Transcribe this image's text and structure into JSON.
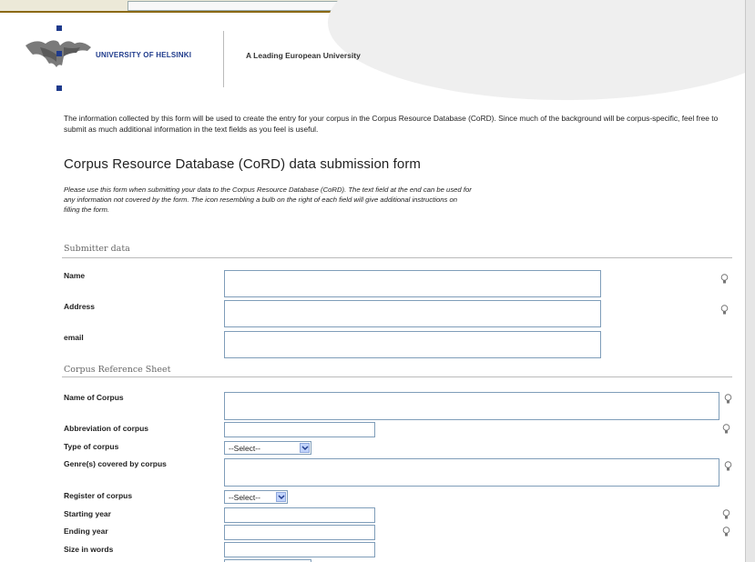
{
  "header": {
    "university_name": "UNIVERSITY OF HELSINKI",
    "tagline": "A Leading European University"
  },
  "intro_text": "The information collected by this form will be used to create the entry for your corpus in the Corpus Resource Database (CoRD). Since much of the background will be corpus-specific, feel free to submit as much additional information in the text fields as you feel is useful.",
  "form": {
    "title": "Corpus Resource Database (CoRD) data submission form",
    "description": "Please use this form when submitting your data to the Corpus Resource Database (CoRD). The text field at the end can be used for any information not covered by the form. The icon resembling a bulb on the right of each field will give additional instructions on filling the form."
  },
  "sections": {
    "submitter": {
      "title": "Submitter data",
      "name_label": "Name",
      "address_label": "Address",
      "email_label": "email"
    },
    "corpus": {
      "title": "Corpus Reference Sheet",
      "name_label": "Name of Corpus",
      "abbrev_label": "Abbreviation of corpus",
      "type_label": "Type of corpus",
      "type_value": "--Select--",
      "genre_label": "Genre(s) covered by corpus",
      "register_label": "Register of corpus",
      "register_value": "--Select--",
      "start_label": "Starting year",
      "end_label": "Ending year",
      "size_label": "Size in words"
    }
  },
  "icons": {
    "logo": "university-crest-icon",
    "help": "bulb-icon",
    "dropdown": "chevron-down-icon"
  },
  "colors": {
    "university_blue": "#1f3b8c",
    "field_border": "#7f9db9",
    "select_arrow": "#c1d3fb"
  }
}
